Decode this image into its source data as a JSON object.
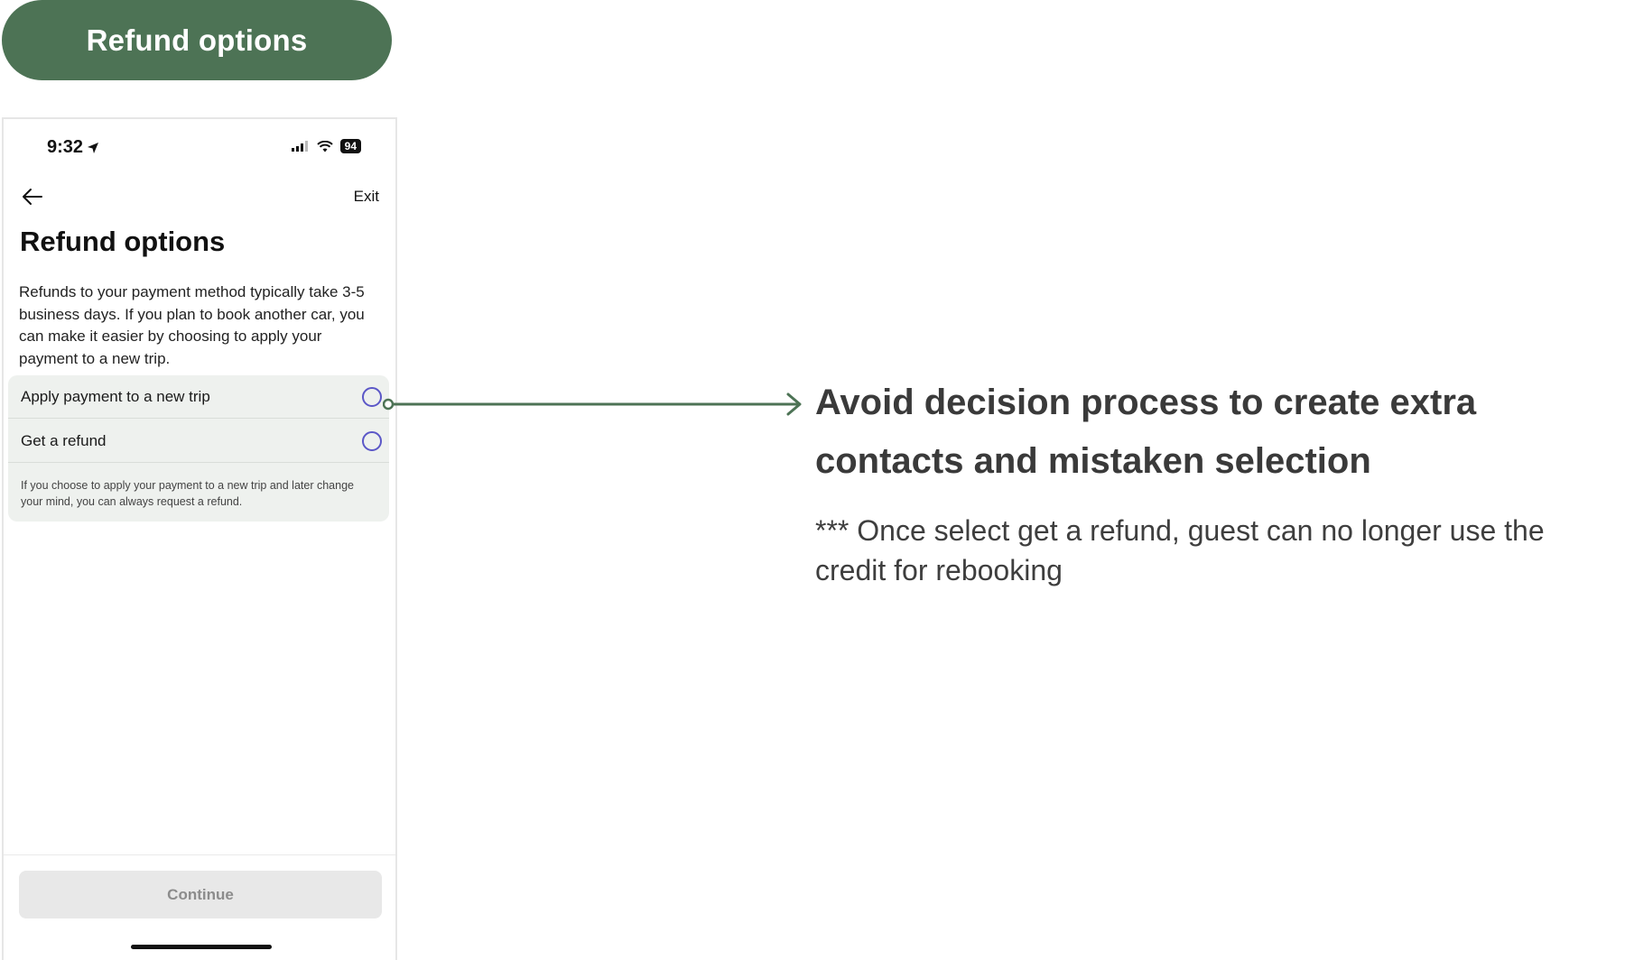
{
  "header": {
    "pill_label": "Refund options"
  },
  "phone": {
    "status_bar": {
      "time": "9:32",
      "battery": "94"
    },
    "nav": {
      "back_icon": "arrow-left-icon",
      "exit_label": "Exit"
    },
    "title": "Refund options",
    "description": "Refunds to your payment method typically take 3-5 business days. If you plan to book another car, you can make it easier by choosing to apply your payment to a new trip.",
    "options": [
      {
        "label": "Apply payment to a new trip",
        "selected": false
      },
      {
        "label": "Get a refund",
        "selected": false
      }
    ],
    "options_note": "If you choose to apply your payment to a new trip and later change your mind, you can always request a refund.",
    "continue_label": "Continue",
    "radio_color": "#5b57c7"
  },
  "annotation": {
    "heading": "Avoid decision process to create extra contacts and mistaken selection",
    "note": "*** Once select get a refund, guest can no longer use the credit for rebooking",
    "accent_color": "#4d7355"
  }
}
